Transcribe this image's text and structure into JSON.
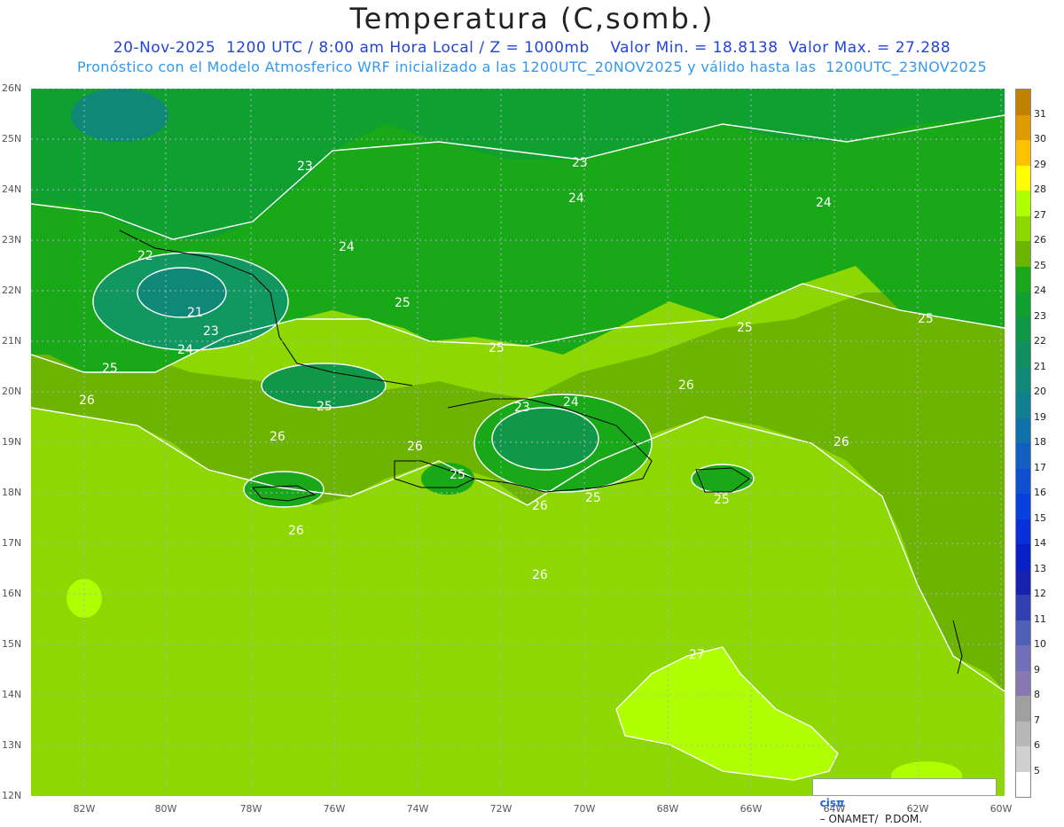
{
  "header": {
    "title": "Temperatura (C,somb.)",
    "line1": "20-Nov-2025  1200 UTC / 8:00 am Hora Local / Z = 1000mb    Valor Min. = 18.8138  Valor Max. = 27.288",
    "line2": "Pronóstico con el Modelo Atmosferico WRF inicializado a las 1200UTC_20NOV2025 y válido hasta las  1200UTC_23NOV2025"
  },
  "map": {
    "lat_labels": [
      "26N",
      "25N",
      "24N",
      "23N",
      "22N",
      "21N",
      "20N",
      "19N",
      "18N",
      "17N",
      "16N",
      "15N",
      "14N",
      "13N",
      "12N"
    ],
    "lon_labels": [
      "82W",
      "80W",
      "78W",
      "76W",
      "74W",
      "72W",
      "70W",
      "68W",
      "66W",
      "64W",
      "62W",
      "60W"
    ],
    "contour_labels": [
      {
        "text": "23"
      },
      {
        "text": "23"
      },
      {
        "text": "24"
      },
      {
        "text": "24"
      },
      {
        "text": "24"
      },
      {
        "text": "22"
      },
      {
        "text": "21"
      },
      {
        "text": "23"
      },
      {
        "text": "24"
      },
      {
        "text": "25"
      },
      {
        "text": "25"
      },
      {
        "text": "25"
      },
      {
        "text": "25"
      },
      {
        "text": "25"
      },
      {
        "text": "26"
      },
      {
        "text": "23"
      },
      {
        "text": "24"
      },
      {
        "text": "25"
      },
      {
        "text": "26"
      },
      {
        "text": "26"
      },
      {
        "text": "26"
      },
      {
        "text": "26"
      },
      {
        "text": "25"
      },
      {
        "text": "26"
      },
      {
        "text": "25"
      },
      {
        "text": "26"
      },
      {
        "text": "26"
      },
      {
        "text": "25"
      },
      {
        "text": "27"
      }
    ],
    "credit": {
      "logo": "cisπ",
      "text": "– ONAMET/  P.DOM."
    }
  },
  "colorbar": {
    "levels": [
      {
        "label": "31",
        "color": "#c08000"
      },
      {
        "label": "30",
        "color": "#e09a00"
      },
      {
        "label": "29",
        "color": "#ffc000"
      },
      {
        "label": "28",
        "color": "#ffff00"
      },
      {
        "label": "27",
        "color": "#b0ff00"
      },
      {
        "label": "26",
        "color": "#8cd800"
      },
      {
        "label": "25",
        "color": "#6cb400"
      },
      {
        "label": "24",
        "color": "#18a818"
      },
      {
        "label": "23",
        "color": "#10a030"
      },
      {
        "label": "22",
        "color": "#109848"
      },
      {
        "label": "21",
        "color": "#109060"
      },
      {
        "label": "20",
        "color": "#108878"
      },
      {
        "label": "19",
        "color": "#108090"
      },
      {
        "label": "18",
        "color": "#1070a8"
      },
      {
        "label": "17",
        "color": "#1060c0"
      },
      {
        "label": "16",
        "color": "#1050d0"
      },
      {
        "label": "15",
        "color": "#0840e0"
      },
      {
        "label": "14",
        "color": "#0830d8"
      },
      {
        "label": "13",
        "color": "#0820c8"
      },
      {
        "label": "12",
        "color": "#1820b0"
      },
      {
        "label": "11",
        "color": "#3040b0"
      },
      {
        "label": "10",
        "color": "#5060b8"
      },
      {
        "label": "9",
        "color": "#7070b8"
      },
      {
        "label": "8",
        "color": "#8878b0"
      },
      {
        "label": "7",
        "color": "#a0a0a0"
      },
      {
        "label": "6",
        "color": "#b8b8b8"
      },
      {
        "label": "5",
        "color": "#d0d0d0"
      },
      {
        "label": "",
        "color": "#ffffff"
      }
    ]
  },
  "colors": {
    "c22": "#108870",
    "c23": "#10a040",
    "c24": "#18a818",
    "c25": "#6cb400",
    "c26": "#8cd800",
    "c27": "#b0ff00"
  }
}
